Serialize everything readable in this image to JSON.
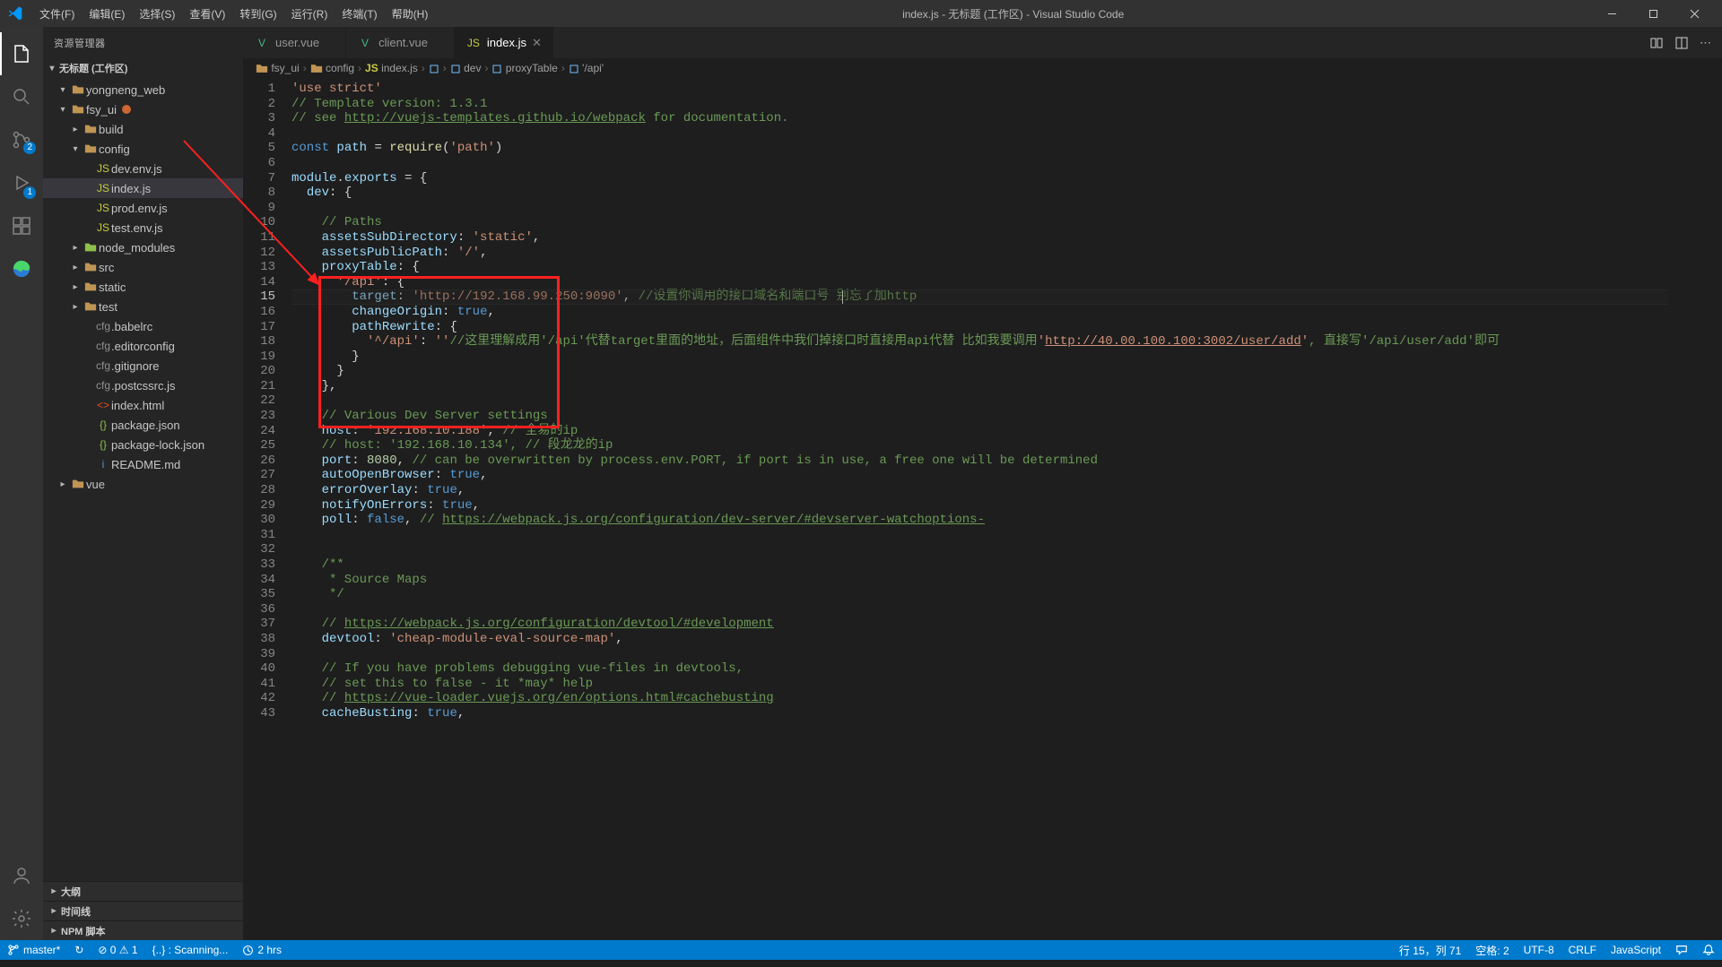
{
  "title": "index.js - 无标题 (工作区) - Visual Studio Code",
  "menubar": [
    "文件(F)",
    "编辑(E)",
    "选择(S)",
    "查看(V)",
    "转到(G)",
    "运行(R)",
    "终端(T)",
    "帮助(H)"
  ],
  "sidebar": {
    "header": "资源管理器",
    "workspace": "无标题 (工作区)",
    "tree": [
      {
        "depth": 1,
        "chev": "v",
        "icon": "folder",
        "iconcls": "folder",
        "label": "yongneng_web"
      },
      {
        "depth": 1,
        "chev": "v",
        "icon": "folder",
        "iconcls": "folder",
        "label": "fsy_ui",
        "dot": true
      },
      {
        "depth": 2,
        "chev": ">",
        "icon": "folder",
        "iconcls": "folder",
        "label": "build"
      },
      {
        "depth": 2,
        "chev": "v",
        "icon": "folder",
        "iconcls": "folder",
        "label": "config"
      },
      {
        "depth": 3,
        "chev": "",
        "icon": "JS",
        "iconcls": "js",
        "label": "dev.env.js"
      },
      {
        "depth": 3,
        "chev": "",
        "icon": "JS",
        "iconcls": "js",
        "label": "index.js",
        "active": true
      },
      {
        "depth": 3,
        "chev": "",
        "icon": "JS",
        "iconcls": "js",
        "label": "prod.env.js"
      },
      {
        "depth": 3,
        "chev": "",
        "icon": "JS",
        "iconcls": "js",
        "label": "test.env.js"
      },
      {
        "depth": 2,
        "chev": ">",
        "icon": "folder",
        "iconcls": "green",
        "label": "node_modules"
      },
      {
        "depth": 2,
        "chev": ">",
        "icon": "folder",
        "iconcls": "folder",
        "label": "src"
      },
      {
        "depth": 2,
        "chev": ">",
        "icon": "folder",
        "iconcls": "folder",
        "label": "static"
      },
      {
        "depth": 2,
        "chev": ">",
        "icon": "folder",
        "iconcls": "folder",
        "label": "test"
      },
      {
        "depth": 3,
        "chev": "",
        "icon": "cfg",
        "iconcls": "gray",
        "label": ".babelrc"
      },
      {
        "depth": 3,
        "chev": "",
        "icon": "cfg",
        "iconcls": "gray",
        "label": ".editorconfig"
      },
      {
        "depth": 3,
        "chev": "",
        "icon": "cfg",
        "iconcls": "gray",
        "label": ".gitignore"
      },
      {
        "depth": 3,
        "chev": "",
        "icon": "cfg",
        "iconcls": "gray",
        "label": ".postcssrc.js"
      },
      {
        "depth": 3,
        "chev": "",
        "icon": "<>",
        "iconcls": "html",
        "label": "index.html"
      },
      {
        "depth": 3,
        "chev": "",
        "icon": "{}",
        "iconcls": "green",
        "label": "package.json"
      },
      {
        "depth": 3,
        "chev": "",
        "icon": "{}",
        "iconcls": "green",
        "label": "package-lock.json"
      },
      {
        "depth": 3,
        "chev": "",
        "icon": "i",
        "iconcls": "blue",
        "label": "README.md"
      },
      {
        "depth": 1,
        "chev": ">",
        "icon": "folder",
        "iconcls": "folder",
        "label": "vue"
      }
    ],
    "panels": [
      "大纲",
      "时间线",
      "NPM 脚本"
    ]
  },
  "tabs": [
    {
      "icon": "V",
      "iconcls": "vue",
      "label": "user.vue"
    },
    {
      "icon": "V",
      "iconcls": "vue",
      "label": "client.vue"
    },
    {
      "icon": "JS",
      "iconcls": "js",
      "label": "index.js",
      "active": true
    }
  ],
  "breadcrumb": [
    "fsy_ui",
    "config",
    "index.js",
    "<unknown>",
    "dev",
    "proxyTable",
    "'/api'"
  ],
  "bc_icons": [
    "folder",
    "folder",
    "js",
    "sym",
    "sym",
    "sym",
    "sym"
  ],
  "code": {
    "url1": "http://vuejs-templates.github.io/webpack",
    "url2": "https://webpack.js.org/configuration/dev-server/#devserver-watchoptions-",
    "url3": "https://webpack.js.org/configuration/devtool/#development",
    "url4": "https://vue-loader.vuejs.org/en/options.html#cachebusting",
    "url5": "http://40.00.100.100:3002/user/add",
    "target": "'http://192.168.99.250:9090'",
    "host": "'192.168.10.188'",
    "host2": "'192.168.10.134'",
    "cm15": "//设置你调用的接口域名和端口号 别忘了加http",
    "cm18a": "//这里理解成用'/api'代替target里面的地址，后面组件中我们掉接口时直接用api代替 比如我要调用",
    "cm18b": ", 直接写'/api/user/add'即可",
    "cm24": "// 全易的ip",
    "cm25": "// 段龙龙的ip",
    "cm26": "// can be overwritten by process.env.PORT, if port is in use, a free one will be determined"
  },
  "status": {
    "branch": "master*",
    "sync": "↻",
    "errs": "⊘ 0 ⚠ 1",
    "scan": "{..} : Scanning...",
    "clock": "2 hrs",
    "pos": "行 15，列 71",
    "spaces": "空格: 2",
    "enc": "UTF-8",
    "eol": "CRLF",
    "lang": "JavaScript"
  },
  "scm_badge": "2",
  "run_badge": "1"
}
